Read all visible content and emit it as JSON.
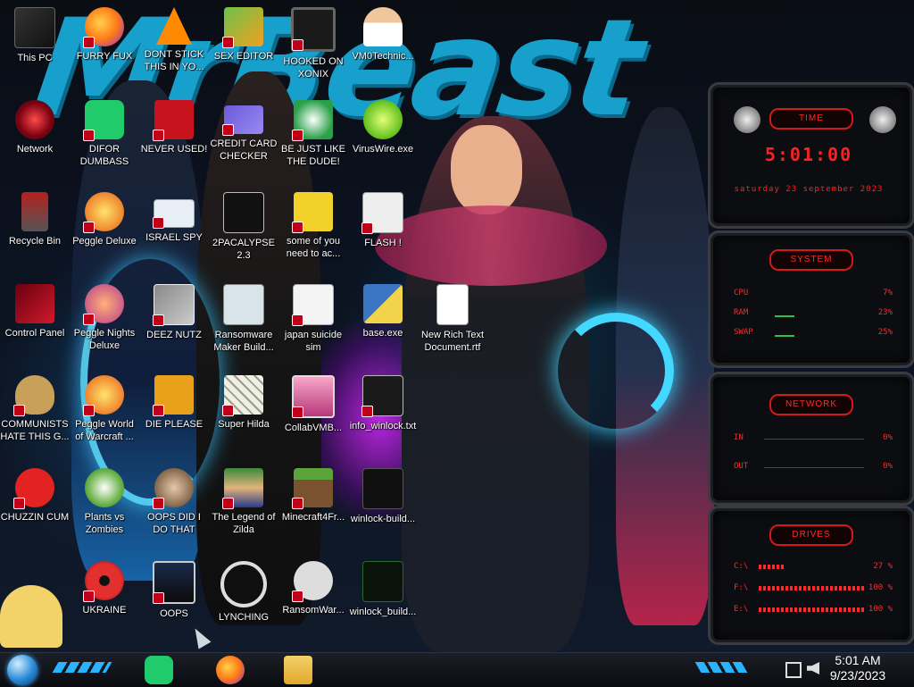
{
  "desktop": {
    "icons": [
      {
        "label": "This PC"
      },
      {
        "label": "FURRY FUX"
      },
      {
        "label": "DONT STICK THIS IN YO..."
      },
      {
        "label": "SEX EDITOR"
      },
      {
        "label": "HOOKED ON XONIX"
      },
      {
        "label": "VM0Technic..."
      },
      {
        "label": "Network"
      },
      {
        "label": "DIFOR DUMBASS"
      },
      {
        "label": "NEVER USED!"
      },
      {
        "label": "CREDIT CARD CHECKER"
      },
      {
        "label": "BE JUST LIKE THE DUDE!"
      },
      {
        "label": "VirusWire.exe"
      },
      {
        "label": "Recycle Bin"
      },
      {
        "label": "Peggle Deluxe"
      },
      {
        "label": "ISRAEL SPY"
      },
      {
        "label": "2PACALYPSE 2.3"
      },
      {
        "label": "some of you need to ac..."
      },
      {
        "label": "FLASH !"
      },
      {
        "label": "Control Panel"
      },
      {
        "label": "Peggle Nights Deluxe"
      },
      {
        "label": "DEEZ NUTZ"
      },
      {
        "label": "Ransomware Maker Build..."
      },
      {
        "label": "japan suicide sim"
      },
      {
        "label": "base.exe"
      },
      {
        "label": "New Rich Text Document.rtf"
      },
      {
        "label": "COMMUNISTS HATE THIS G..."
      },
      {
        "label": "Peggle World of Warcraft ..."
      },
      {
        "label": "DIE PLEASE"
      },
      {
        "label": "Super Hilda"
      },
      {
        "label": "CollabVMB..."
      },
      {
        "label": "info_winlock.txt"
      },
      {
        "label": "CHUZZIN CUM"
      },
      {
        "label": "Plants vs Zombies"
      },
      {
        "label": "OOPS DID I DO THAT"
      },
      {
        "label": "The Legend of Zilda"
      },
      {
        "label": "Minecraft4Fr..."
      },
      {
        "label": "winlock-build..."
      },
      {
        "label": "UKRAINE"
      },
      {
        "label": "OOPS"
      },
      {
        "label": "LYNCHING"
      },
      {
        "label": "RansomWar..."
      },
      {
        "label": "winlock_build..."
      }
    ]
  },
  "widgets": {
    "time": {
      "title": "TIME",
      "clock": "5:01:00",
      "date": "saturday 23 september 2023"
    },
    "system": {
      "title": "SYSTEM",
      "rows": [
        {
          "label": "CPU",
          "value": "7%"
        },
        {
          "label": "RAM",
          "value": "23%"
        },
        {
          "label": "SWAP",
          "value": "25%"
        }
      ]
    },
    "network": {
      "title": "NETWORK",
      "rows": [
        {
          "label": "IN",
          "value": "0%"
        },
        {
          "label": "OUT",
          "value": "0%"
        }
      ]
    },
    "drives": {
      "title": "DRIVES",
      "rows": [
        {
          "label": "C:\\",
          "value": "27 %"
        },
        {
          "label": "F:\\",
          "value": "100 %"
        },
        {
          "label": "E:\\",
          "value": "100 %"
        }
      ]
    }
  },
  "taskbar": {
    "clock_time": "5:01 AM",
    "clock_date": "9/23/2023"
  },
  "colors": {
    "accent": "#ff2020",
    "wallpaper_title": "#18a8d6"
  }
}
